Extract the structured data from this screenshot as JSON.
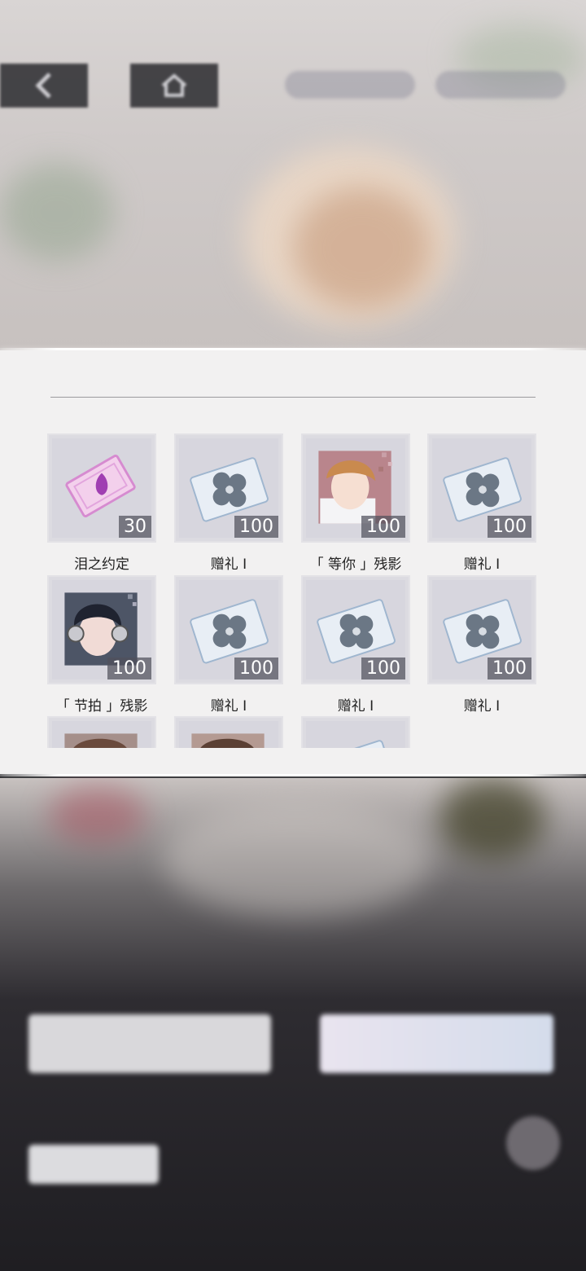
{
  "rewards": [
    {
      "name": "泪之约定",
      "qty": "30",
      "icon": "ticket-icon"
    },
    {
      "name": "赠礼 I",
      "qty": "100",
      "icon": "gift-folder-icon"
    },
    {
      "name": "「 等你 」残影",
      "qty": "100",
      "icon": "brown-hair-portrait"
    },
    {
      "name": "赠礼 I",
      "qty": "100",
      "icon": "gift-folder-icon"
    },
    {
      "name": "「 节拍 」残影",
      "qty": "100",
      "icon": "headphone-portrait"
    },
    {
      "name": "赠礼 I",
      "qty": "100",
      "icon": "gift-folder-icon"
    },
    {
      "name": "赠礼 I",
      "qty": "100",
      "icon": "gift-folder-icon"
    },
    {
      "name": "赠礼 I",
      "qty": "100",
      "icon": "gift-folder-icon"
    }
  ],
  "colors": {
    "modal_bg": "#f2f1f1",
    "tile_bg": "#dcdbe1",
    "qty_bg": "#50505c"
  }
}
